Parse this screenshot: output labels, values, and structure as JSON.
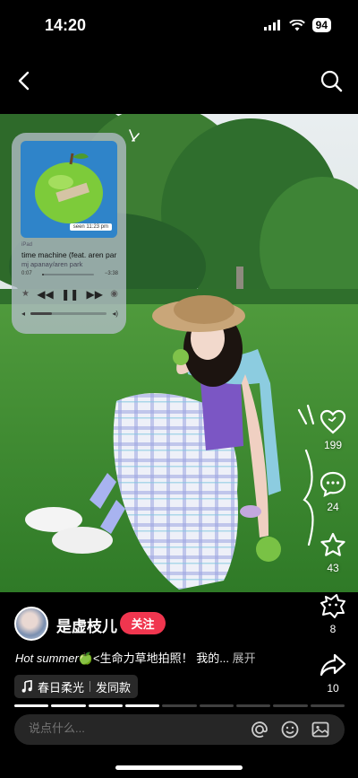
{
  "status": {
    "time": "14:20",
    "battery": "94"
  },
  "music": {
    "seen": "seen 11:23 pm",
    "device": "iPad",
    "title": "time machine (feat. aren par",
    "artist": "mj apanay/aren park",
    "elapsed": "0:07",
    "remaining": "−3:38",
    "progress": 0.03,
    "volume": 0.28
  },
  "actions": {
    "likes": "199",
    "comments": "24",
    "favorites": "43",
    "collect": "8",
    "shares": "10"
  },
  "author": {
    "name": "是虚枝儿",
    "follow": "关注"
  },
  "caption": {
    "en": "Hot summer",
    "emoji": "🍏",
    "text": "<生命力草地拍照！ 我的...",
    "more": "展开"
  },
  "tag": {
    "icon": "music-note-icon",
    "label": "春日柔光",
    "action": "发同款"
  },
  "pages": {
    "count": 9,
    "active": [
      0,
      1,
      2,
      3
    ]
  },
  "comment": {
    "placeholder": "说点什么..."
  }
}
